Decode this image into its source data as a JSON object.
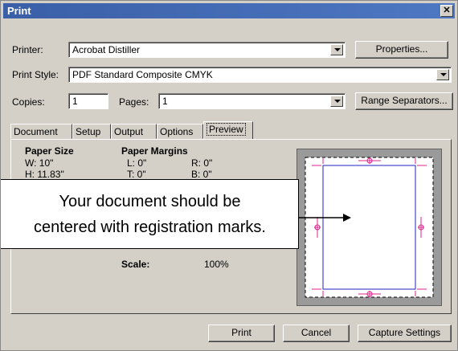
{
  "window": {
    "title": "Print",
    "close_glyph": "✕"
  },
  "printer": {
    "label": "Printer:",
    "value": "Acrobat Distiller",
    "properties_label": "Properties..."
  },
  "print_style": {
    "label": "Print Style:",
    "value": "PDF Standard Composite CMYK"
  },
  "copies": {
    "label": "Copies:",
    "value": "1"
  },
  "pages": {
    "label": "Pages:",
    "value": "1",
    "range_label": "Range Separators..."
  },
  "tabs": [
    {
      "label": "Document"
    },
    {
      "label": "Setup"
    },
    {
      "label": "Output"
    },
    {
      "label": "Options"
    },
    {
      "label": "Preview",
      "active": true
    }
  ],
  "preview": {
    "paper_size_heading": "Paper Size",
    "width": "W: 10\"",
    "height": "H: 11.83\"",
    "paper_margins_heading": "Paper Margins",
    "margin_left": "L: 0\"",
    "margin_right": "R: 0\"",
    "margin_top": "T: 0\"",
    "margin_bottom": "B: 0\"",
    "scale_label": "Scale:",
    "scale_value": "100%"
  },
  "callout": {
    "line1": "Your document should be",
    "line2": "centered with registration marks."
  },
  "buttons": {
    "print": "Print",
    "cancel": "Cancel",
    "capture": "Capture Settings"
  },
  "colors": {
    "registration": "#e0208a",
    "page_border": "#2020c0",
    "titlebar": "#3a5fa8"
  }
}
